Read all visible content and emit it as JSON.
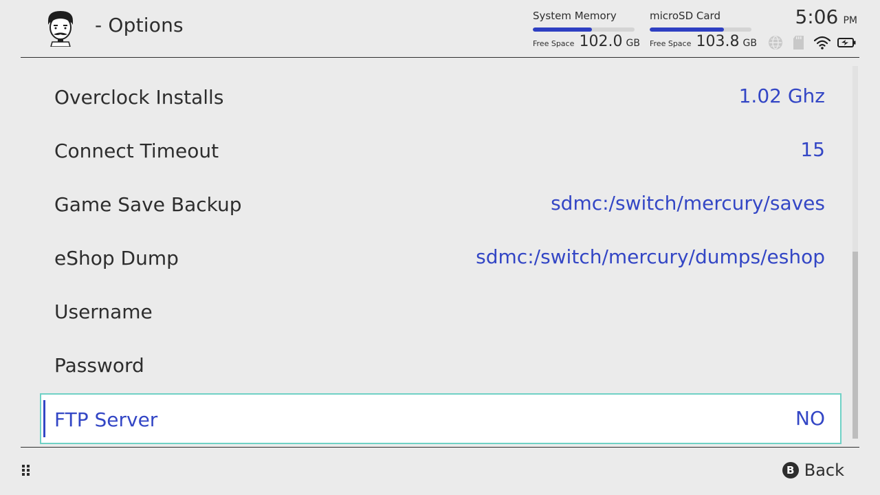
{
  "header": {
    "title": "- Options",
    "avatar_icon": "mustache-face-icon",
    "system_memory": {
      "label": "System Memory",
      "free_label": "Free Space",
      "free_value": "102.0",
      "free_unit": "GB",
      "used_fraction": 0.58
    },
    "microsd": {
      "label": "microSD Card",
      "free_label": "Free Space",
      "free_value": "103.8",
      "free_unit": "GB",
      "used_fraction": 0.73
    },
    "clock": {
      "time": "5:06",
      "ampm": "PM"
    },
    "status_icons": [
      "globe-icon",
      "sd-card-icon",
      "wifi-icon",
      "battery-charging-icon"
    ]
  },
  "options": [
    {
      "label": "Overclock Installs",
      "value": "1.02 Ghz"
    },
    {
      "label": "Connect Timeout",
      "value": "15"
    },
    {
      "label": "Game Save Backup",
      "value": "sdmc:/switch/mercury/saves"
    },
    {
      "label": "eShop Dump",
      "value": "sdmc:/switch/mercury/dumps/eshop"
    },
    {
      "label": "Username",
      "value": ""
    },
    {
      "label": "Password",
      "value": ""
    },
    {
      "label": "FTP Server",
      "value": "NO",
      "selected": true
    }
  ],
  "footer": {
    "menu_icon": "grid-dots-icon",
    "back_glyph": "B",
    "back_label": "Back"
  },
  "colors": {
    "background": "#ebebeb",
    "accent": "#3346c5",
    "selection_border": "#6fd1c5",
    "text": "#2d2d2d"
  }
}
